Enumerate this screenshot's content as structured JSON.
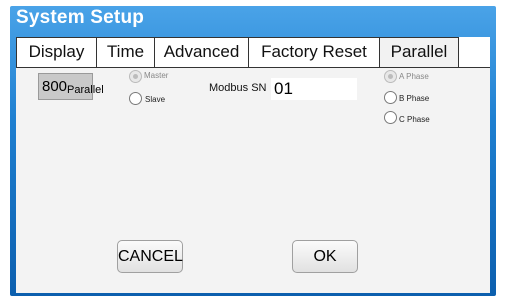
{
  "window": {
    "title": "System Setup"
  },
  "tabs": [
    {
      "label": "Display"
    },
    {
      "label": "Time"
    },
    {
      "label": "Advanced"
    },
    {
      "label": "Factory Reset"
    },
    {
      "label": "Parallel"
    }
  ],
  "active_tab": "Parallel",
  "parallel": {
    "model_value": "800",
    "model_suffix": "Parallel",
    "role_options": [
      {
        "label": "Master",
        "selected": true
      },
      {
        "label": "Slave",
        "selected": false
      }
    ],
    "modbus_sn_label": "Modbus SN",
    "modbus_sn_value": "01",
    "phase_options": [
      {
        "label": "A Phase",
        "selected": true
      },
      {
        "label": "B Phase",
        "selected": false
      },
      {
        "label": "C Phase",
        "selected": false
      }
    ]
  },
  "actions": {
    "cancel_label": "CANCEL",
    "ok_label": "OK"
  },
  "colors": {
    "header_blue": "#1e7fd0",
    "panel_bg": "#f3f3f3"
  }
}
